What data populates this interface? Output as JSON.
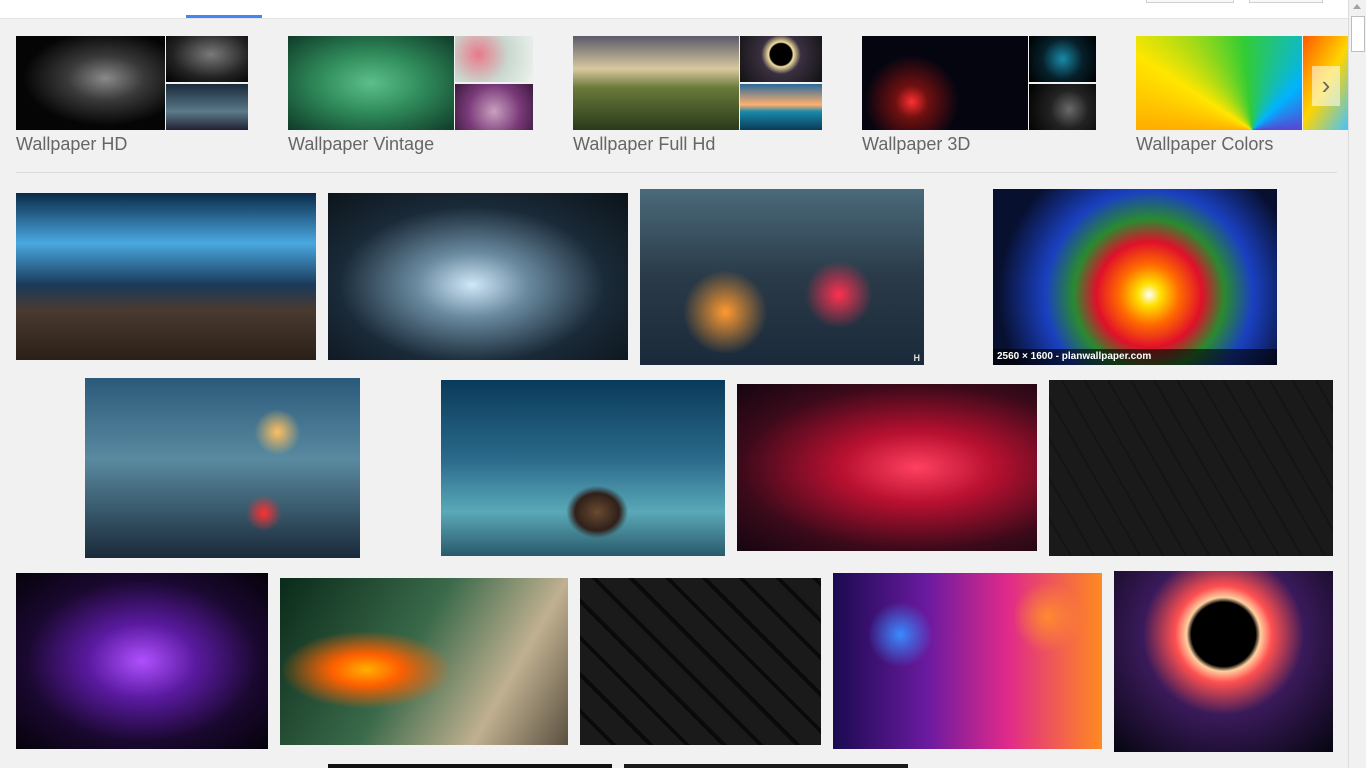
{
  "related": [
    {
      "label": "Wallpaper HD"
    },
    {
      "label": "Wallpaper Vintage"
    },
    {
      "label": "Wallpaper Full Hd"
    },
    {
      "label": "Wallpaper 3D"
    },
    {
      "label": "Wallpaper Colors"
    }
  ],
  "next_arrow": "›",
  "results": {
    "hover_caption": "2560 × 1600 - planwallpaper.com",
    "watermark": "H"
  },
  "colors": {
    "accent": "#4285f4",
    "background": "#f1f1f1",
    "label": "#666666"
  }
}
